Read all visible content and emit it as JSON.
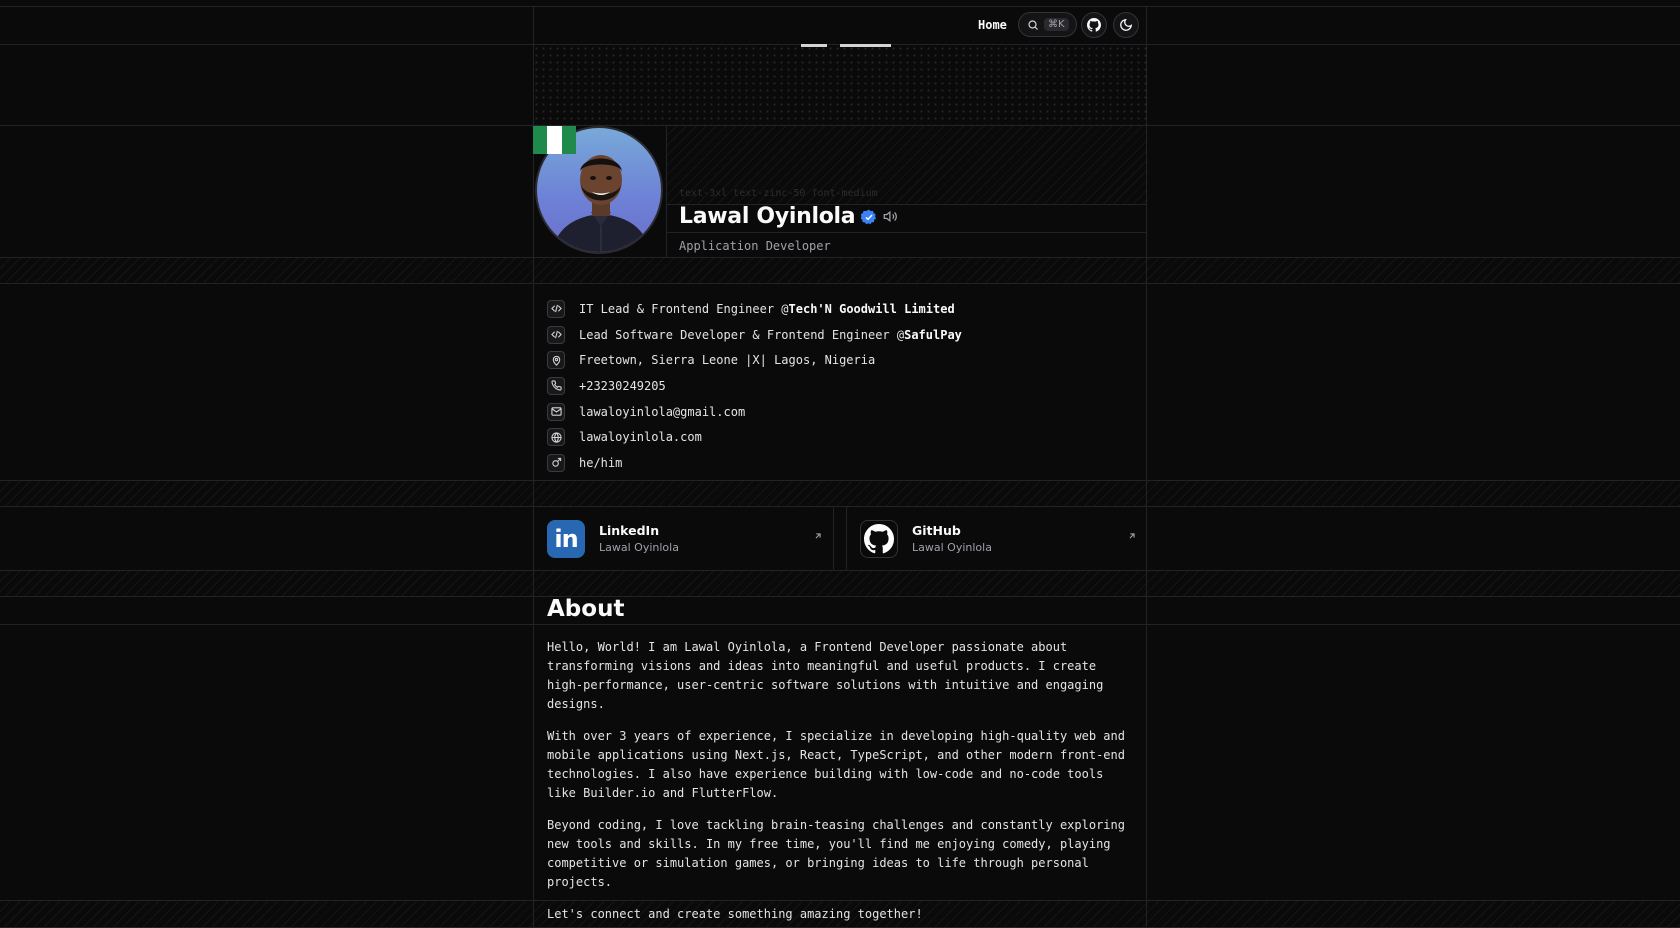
{
  "header": {
    "nav_home": "Home",
    "search_shortcut": "⌘K",
    "icons": [
      "search-icon",
      "github-icon",
      "theme-toggle-icon"
    ]
  },
  "profile": {
    "class_hint": "text-3xl text-zinc-50 font-medium",
    "name": "Lawal Oyinlola",
    "role": "Application Developer",
    "flag": "nigeria",
    "colors": {
      "verified": "#3b82f6",
      "flag_green": "#1f8a4c",
      "flag_white": "#ffffff"
    }
  },
  "details": [
    {
      "icon": "code-icon",
      "prefix": "IT Lead & Frontend Engineer @",
      "strong": "Tech'N Goodwill Limited"
    },
    {
      "icon": "code-icon",
      "prefix": "Lead Software Developer & Frontend Engineer @",
      "strong": "SafulPay"
    },
    {
      "icon": "map-pin-icon",
      "prefix": "Freetown, Sierra Leone |X| Lagos, Nigeria",
      "strong": ""
    },
    {
      "icon": "phone-icon",
      "prefix": "+23230249205",
      "strong": ""
    },
    {
      "icon": "mail-icon",
      "prefix": "lawaloyinlola@gmail.com",
      "strong": ""
    },
    {
      "icon": "globe-icon",
      "prefix": "lawaloyinlola.com",
      "strong": ""
    },
    {
      "icon": "mars-icon",
      "prefix": "he/him",
      "strong": ""
    }
  ],
  "socials": [
    {
      "name": "LinkedIn",
      "handle": "Lawal Oyinlola",
      "color": "#2867b2"
    },
    {
      "name": "GitHub",
      "handle": "Lawal Oyinlola",
      "color": "#ffffff"
    }
  ],
  "about": {
    "title": "About",
    "paragraphs": [
      "Hello, World! I am Lawal Oyinlola, a Frontend Developer passionate about transforming visions and ideas into meaningful and useful products. I create high-performance, user-centric software solutions with intuitive and engaging designs.",
      "With over 3 years of experience, I specialize in developing high-quality web and mobile applications using Next.js, React, TypeScript, and other modern front-end technologies. I also have experience building with low-code and no-code tools like Builder.io and FlutterFlow.",
      "Beyond coding, I love tackling brain-teasing challenges and constantly exploring new tools and skills. In my free time, you'll find me enjoying comedy, playing competitive or simulation games, or bringing ideas to life through personal projects.",
      "Let's connect and create something amazing together!"
    ]
  }
}
